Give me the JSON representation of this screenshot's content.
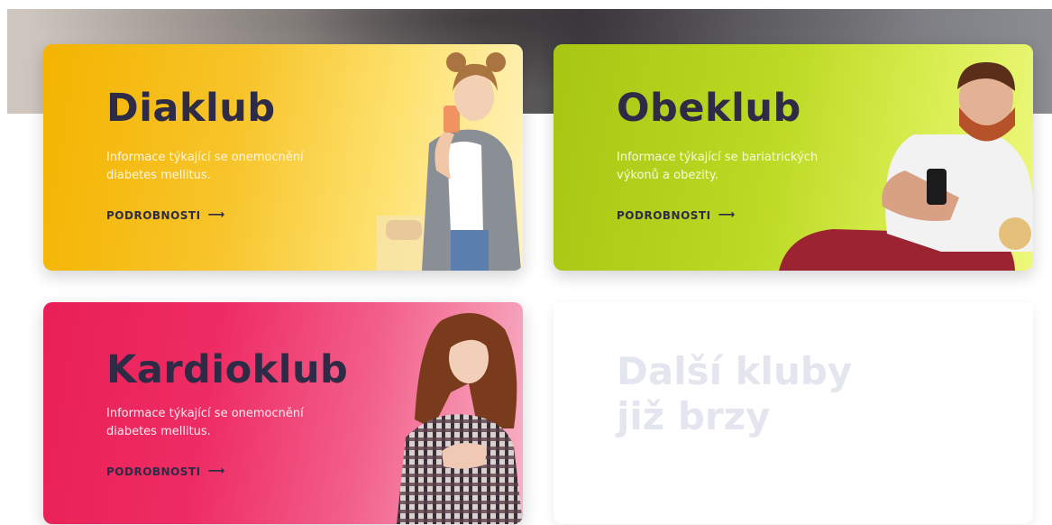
{
  "clubs": [
    {
      "title": "Diaklub",
      "description": "Informace týkající se onemocnění diabetes mellitus.",
      "link_label": "PODROBNOSTI",
      "color": "#f4b400"
    },
    {
      "title": "Obeklub",
      "description": "Informace týkající se bariatrických výkonů a obezity.",
      "link_label": "PODROBNOSTI",
      "color": "#a7c613"
    },
    {
      "title": "Kardioklub",
      "description": "Informace týkající se onemocnění diabetes mellitus.",
      "link_label": "PODROBNOSTI",
      "color": "#e91f57"
    }
  ],
  "coming_soon": {
    "title": "Další kluby již brzy"
  },
  "icons": {
    "link_arrow": "arrow-right-icon"
  }
}
